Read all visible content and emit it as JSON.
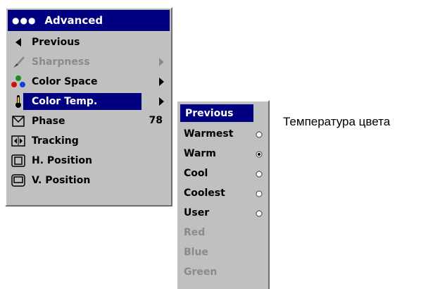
{
  "menu": {
    "title": "Advanced",
    "items": [
      {
        "label": "Previous"
      },
      {
        "label": "Sharpness"
      },
      {
        "label": "Color Space"
      },
      {
        "label": "Color Temp."
      },
      {
        "label": "Phase",
        "value": "78"
      },
      {
        "label": "Tracking"
      },
      {
        "label": "H. Position"
      },
      {
        "label": "V. Position"
      }
    ]
  },
  "submenu": {
    "items": [
      {
        "label": "Previous"
      },
      {
        "label": "Warmest",
        "selected": false
      },
      {
        "label": "Warm",
        "selected": true
      },
      {
        "label": "Cool",
        "selected": false
      },
      {
        "label": "Coolest",
        "selected": false
      },
      {
        "label": "User",
        "selected": false
      },
      {
        "label": "Red"
      },
      {
        "label": "Blue"
      },
      {
        "label": "Green"
      }
    ]
  },
  "caption": "Температура цвета"
}
